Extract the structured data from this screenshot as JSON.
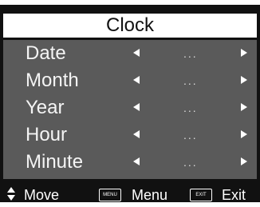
{
  "title": "Clock",
  "rows": [
    {
      "label": "Date",
      "value": "..."
    },
    {
      "label": "Month",
      "value": "..."
    },
    {
      "label": "Year",
      "value": "..."
    },
    {
      "label": "Hour",
      "value": "..."
    },
    {
      "label": "Minute",
      "value": "..."
    }
  ],
  "footer": {
    "move_label": "Move",
    "menu_key": "MENU",
    "menu_label": "Menu",
    "exit_key": "EXIT",
    "exit_label": "Exit"
  },
  "colors": {
    "background": "#111111",
    "panel": "#5a5a5a",
    "title_bar": "#ffffff",
    "text": "#ffffff"
  }
}
